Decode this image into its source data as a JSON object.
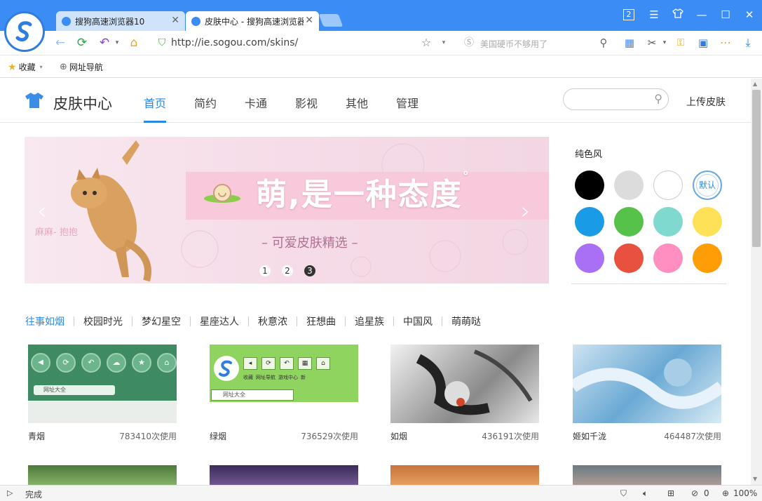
{
  "tabs": [
    {
      "title": "搜狗高速浏览器10"
    },
    {
      "title": "皮肤中心 - 搜狗高速浏览器"
    }
  ],
  "window": {
    "counter": "2"
  },
  "address": {
    "url": "http://ie.sogou.com/skins/",
    "search_placeholder": "美国硬币不够用了"
  },
  "bookmarks": {
    "favorites": "收藏",
    "nav": "网址导航"
  },
  "site": {
    "title": "皮肤中心",
    "nav": [
      "首页",
      "简约",
      "卡通",
      "影视",
      "其他",
      "管理"
    ],
    "upload": "上传皮肤"
  },
  "banner": {
    "headline": "萌,是一种态度",
    "degree": "°",
    "subtitle": "– 可爱皮肤精选 –",
    "side_text": "麻麻- 抱抱",
    "dots": [
      "1",
      "2",
      "3"
    ]
  },
  "pure": {
    "title": "纯色风",
    "default_label": "默认",
    "colors": [
      "#000000",
      "#dcdcdc",
      "#ffffff",
      "default",
      "#1a9be6",
      "#56c24a",
      "#7fd9cf",
      "#ffe157",
      "#a970f5",
      "#e8513f",
      "#ff8fc0",
      "#ff9d06"
    ]
  },
  "categories": [
    "往事如烟",
    "校园时光",
    "梦幻星空",
    "星座达人",
    "秋意浓",
    "狂想曲",
    "追星族",
    "中国风",
    "萌萌哒"
  ],
  "skins": [
    {
      "name": "青烟",
      "uses": "783410次使用",
      "address_label": "网址大全"
    },
    {
      "name": "绿烟",
      "uses": "736529次使用",
      "address_label": "网址大全",
      "menu": [
        "收藏",
        "网址导航",
        "游戏中心",
        "新"
      ]
    },
    {
      "name": "如烟",
      "uses": "436191次使用"
    },
    {
      "name": "姬如千泷",
      "uses": "464487次使用"
    }
  ],
  "status": {
    "text": "完成",
    "count": "0",
    "zoom": "100%"
  }
}
